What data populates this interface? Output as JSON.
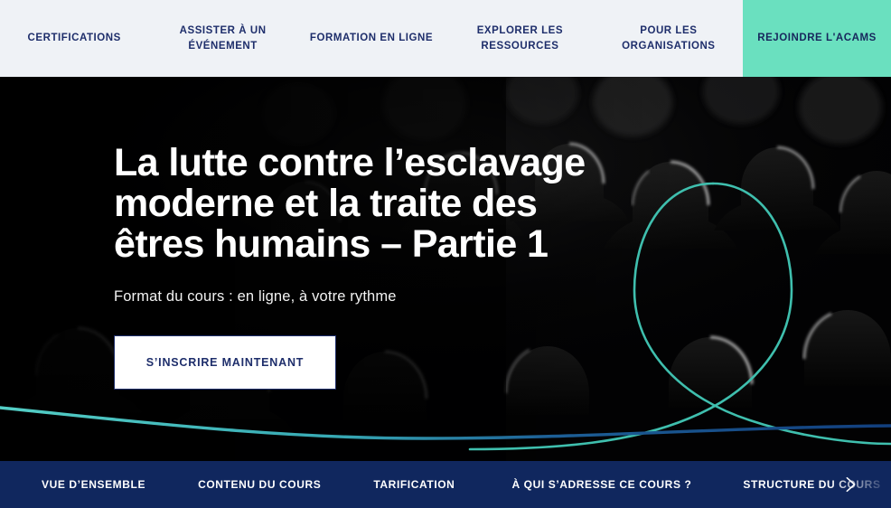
{
  "topnav": {
    "items": [
      {
        "label": "CERTIFICATIONS",
        "name": "nav-certifications"
      },
      {
        "label": "ASSISTER À UN ÉVÉNEMENT",
        "name": "nav-assister-evenement"
      },
      {
        "label": "FORMATION EN LIGNE",
        "name": "nav-formation-en-ligne"
      },
      {
        "label": "EXPLORER LES RESSOURCES",
        "name": "nav-explorer-ressources"
      },
      {
        "label": "POUR LES ORGANISATIONS",
        "name": "nav-pour-organisations"
      }
    ],
    "cta": {
      "label": "REJOINDRE L'ACAMS",
      "name": "nav-rejoindre-acams"
    }
  },
  "hero": {
    "title": "La lutte contre l’esclavage\nmoderne et la traite des\nêtres humains – Partie 1",
    "subtitle": "Format du cours : en ligne, à votre rythme",
    "cta_label": "S’INSCRIRE MAINTENANT"
  },
  "bottomnav": {
    "items": [
      {
        "label": "VUE D’ENSEMBLE",
        "name": "subnav-vue-ensemble"
      },
      {
        "label": "CONTENU DU COURS",
        "name": "subnav-contenu-du-cours"
      },
      {
        "label": "TARIFICATION",
        "name": "subnav-tarification"
      },
      {
        "label": "À QUI S’ADRESSE CE COURS ?",
        "name": "subnav-a-qui-sadresse"
      },
      {
        "label": "STRUCTURE DU COURS",
        "name": "subnav-structure-du-cours"
      }
    ],
    "next_icon": "chevron-right-icon"
  },
  "colors": {
    "nav_background": "#eff2f6",
    "nav_text": "#1e2e6b",
    "accent_mint": "#6ae0bf",
    "hero_background": "#020203",
    "navy": "#10275e",
    "ribbon_teal": "#3fbfae",
    "ribbon_blue": "#123f7e",
    "white": "#ffffff"
  }
}
